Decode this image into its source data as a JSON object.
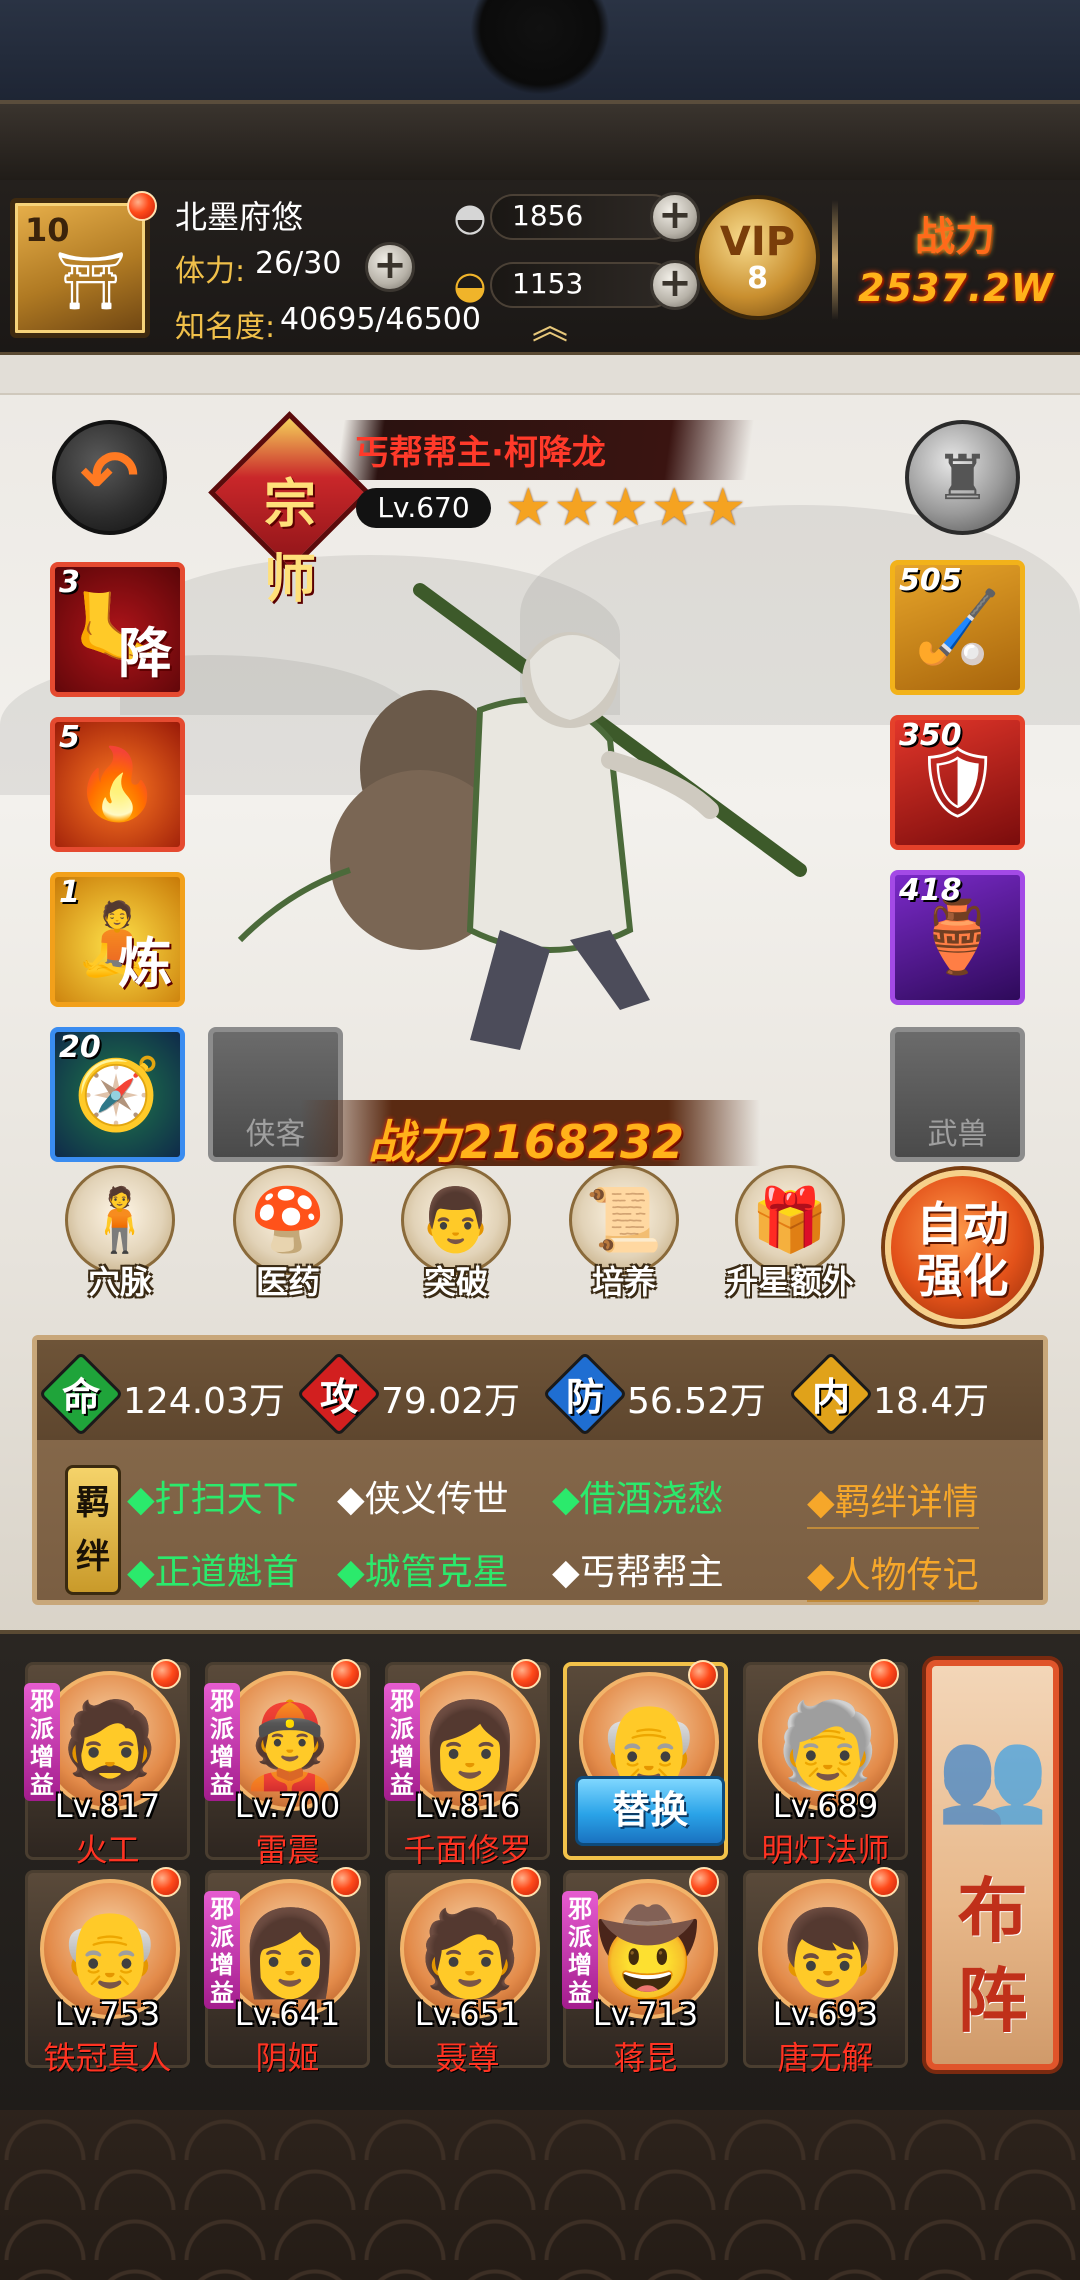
{
  "player": {
    "level": "10",
    "name": "北墨府悠",
    "stamina_label": "体力:",
    "stamina": "26/30",
    "fame_label": "知名度:",
    "fame": "40695/46500"
  },
  "currency": {
    "silver": "1856",
    "gold": "1153"
  },
  "vip": {
    "label": "VIP",
    "level": "8"
  },
  "power": {
    "label": "战力",
    "value": "2537.2W"
  },
  "hero": {
    "name": "丐帮帮主·柯降龙",
    "rank": "宗师",
    "level": "Lv.670",
    "stars": "★★★★★",
    "power": "战力2168232"
  },
  "skills": [
    {
      "num": "3",
      "glyph": "降"
    },
    {
      "num": "5",
      "glyph": ""
    },
    {
      "num": "1",
      "glyph": "炼"
    },
    {
      "num": "20",
      "glyph": ""
    }
  ],
  "equipment": [
    {
      "num": "505"
    },
    {
      "num": "350"
    },
    {
      "num": "418"
    }
  ],
  "empty_slots": {
    "companion": "侠客",
    "beast": "武兽"
  },
  "actions": [
    "穴脉",
    "医药",
    "突破",
    "培养",
    "升星额外"
  ],
  "auto_button": {
    "line1": "自动",
    "line2": "强化"
  },
  "stats": [
    {
      "char": "命",
      "value": "124.03万",
      "color": "#1fa43a"
    },
    {
      "char": "攻",
      "value": "79.02万",
      "color": "#d21f1f"
    },
    {
      "char": "防",
      "value": "56.52万",
      "color": "#1f6ed2"
    },
    {
      "char": "内",
      "value": "18.4万",
      "color": "#e0a21a"
    }
  ],
  "bond_tag": {
    "line1": "羁",
    "line2": "绊"
  },
  "bonds": [
    {
      "text": "◆打扫天下",
      "active": true
    },
    {
      "text": "◆侠义传世",
      "active": false
    },
    {
      "text": "◆借酒浇愁",
      "active": true
    },
    {
      "text": "◆正道魁首",
      "active": true
    },
    {
      "text": "◆城管克星",
      "active": true
    },
    {
      "text": "◆丐帮帮主",
      "active": false
    }
  ],
  "links": {
    "bond_detail": "◆羁绊详情",
    "biography": "◆人物传记"
  },
  "roster": [
    {
      "level": "Lv.817",
      "name": "火工",
      "evil": true
    },
    {
      "level": "Lv.700",
      "name": "雷震",
      "evil": true
    },
    {
      "level": "Lv.816",
      "name": "千面修罗",
      "evil": true
    },
    {
      "level": "",
      "name": "",
      "evil": false,
      "selected": true
    },
    {
      "level": "Lv.689",
      "name": "明灯法师",
      "evil": false
    },
    {
      "level": "Lv.753",
      "name": "铁冠真人",
      "evil": false
    },
    {
      "level": "Lv.641",
      "name": "阴姬",
      "evil": true
    },
    {
      "level": "Lv.651",
      "name": "聂尊",
      "evil": false
    },
    {
      "level": "Lv.713",
      "name": "蒋昆",
      "evil": true
    },
    {
      "level": "Lv.693",
      "name": "唐无解",
      "evil": false
    }
  ],
  "evil_tag": "邪派增益",
  "replace_label": "替换",
  "formation_label": "布阵"
}
